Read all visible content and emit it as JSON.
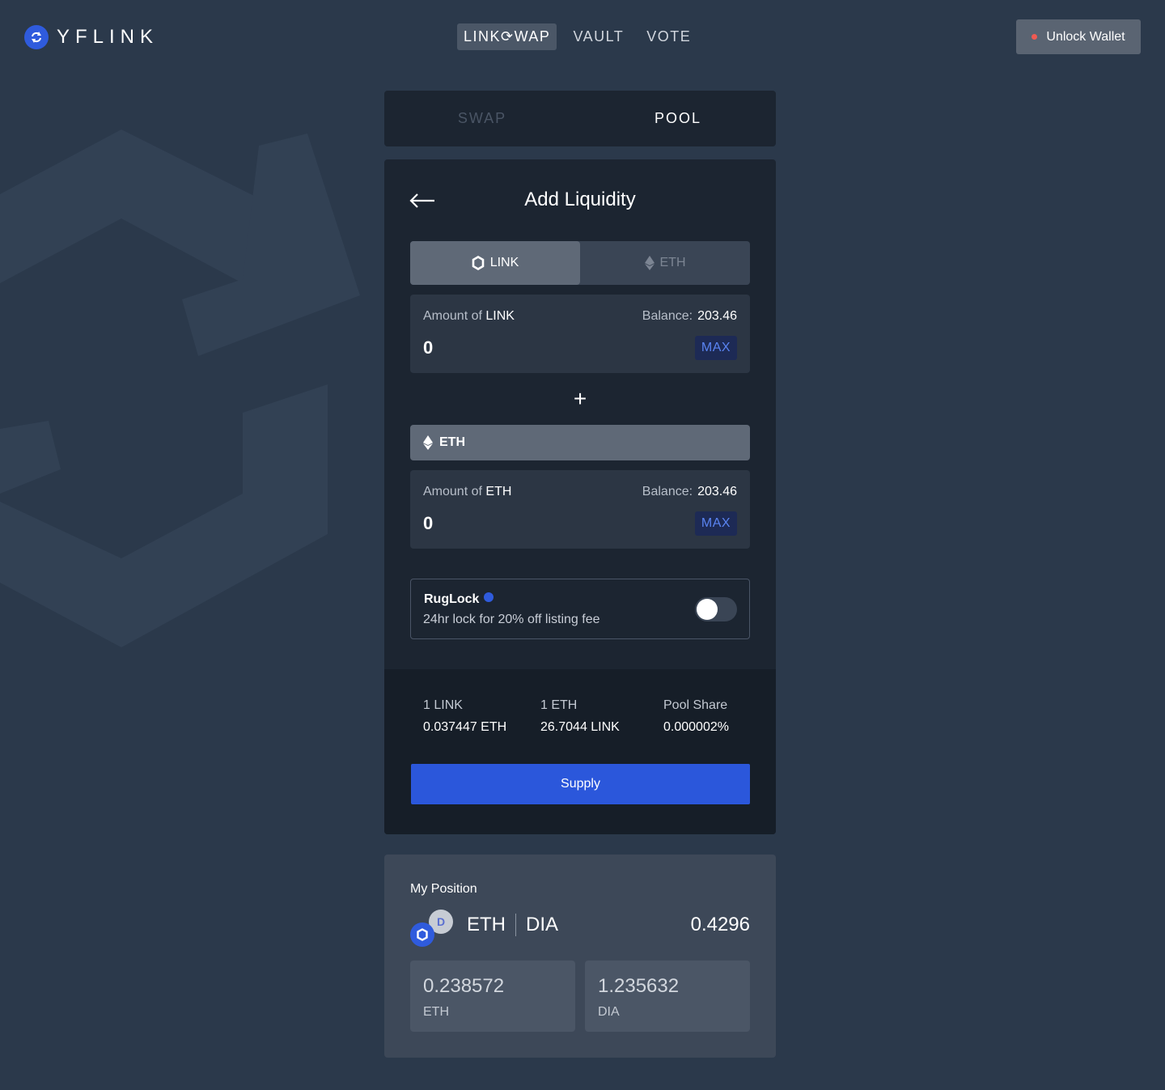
{
  "header": {
    "brand": "YFLINK",
    "nav": [
      {
        "label": "LINK⟳WAP",
        "active": true
      },
      {
        "label": "VAULT",
        "active": false
      },
      {
        "label": "VOTE",
        "active": false
      }
    ],
    "unlock_wallet": "Unlock Wallet"
  },
  "tabs": {
    "swap": "SWAP",
    "pool": "POOL"
  },
  "add_liquidity": {
    "title": "Add Liquidity",
    "toggle": {
      "first": "LINK",
      "second": "ETH"
    },
    "link_input": {
      "label_prefix": "Amount of",
      "token": "LINK",
      "balance_label": "Balance:",
      "balance_value": "203.46",
      "value": "0",
      "max": "MAX"
    },
    "plus": "+",
    "eth_selector": "ETH",
    "eth_input": {
      "label_prefix": "Amount of",
      "token": "ETH",
      "balance_label": "Balance:",
      "balance_value": "203.46",
      "value": "0",
      "max": "MAX"
    },
    "ruglock": {
      "title": "RugLock",
      "subtitle": "24hr lock for 20% off listing fee",
      "enabled": false
    },
    "stats": [
      {
        "label": "1 LINK",
        "value": "0.037447 ETH"
      },
      {
        "label": "1 ETH",
        "value": "26.7044 LINK"
      },
      {
        "label": "Pool Share",
        "value": "0.000002%"
      }
    ],
    "supply": "Supply"
  },
  "my_position": {
    "title": "My Position",
    "pair_a": "ETH",
    "pair_b": "DIA",
    "dia_icon_letter": "D",
    "total": "0.4296",
    "amounts": [
      {
        "value": "0.238572",
        "token": "ETH"
      },
      {
        "value": "1.235632",
        "token": "DIA"
      }
    ]
  },
  "colors": {
    "background": "#2b394b",
    "card": "#1c2531",
    "accent": "#2b57db",
    "max_text": "#5a84f2",
    "wallet_dot": "#ef5a52"
  }
}
